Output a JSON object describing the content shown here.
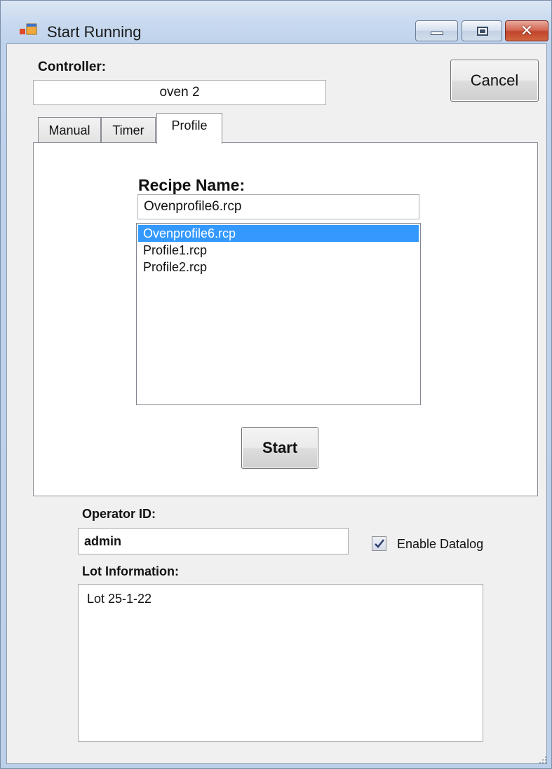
{
  "window": {
    "title": "Start Running"
  },
  "controller": {
    "label": "Controller:",
    "value": "oven 2"
  },
  "cancel_button": "Cancel",
  "tabs": [
    {
      "label": "Manual"
    },
    {
      "label": "Timer"
    },
    {
      "label": "Profile"
    }
  ],
  "recipe": {
    "label": "Recipe Name:",
    "value": "Ovenprofile6.rcp",
    "list": [
      "Ovenprofile6.rcp",
      "Profile1.rcp",
      "Profile2.rcp"
    ],
    "selected": "Ovenprofile6.rcp"
  },
  "start_button": "Start",
  "operator": {
    "label": "Operator ID:",
    "value": "admin"
  },
  "datalog": {
    "label": "Enable Datalog",
    "checked": true
  },
  "lot": {
    "label": "Lot Information:",
    "value": "Lot 25-1-22"
  },
  "colors": {
    "selection": "#3399ff",
    "close_button": "#c0442c"
  },
  "icons": [
    "app-icon",
    "minimize-icon",
    "maximize-icon",
    "close-icon",
    "checkmark-icon",
    "resize-grip-icon"
  ]
}
